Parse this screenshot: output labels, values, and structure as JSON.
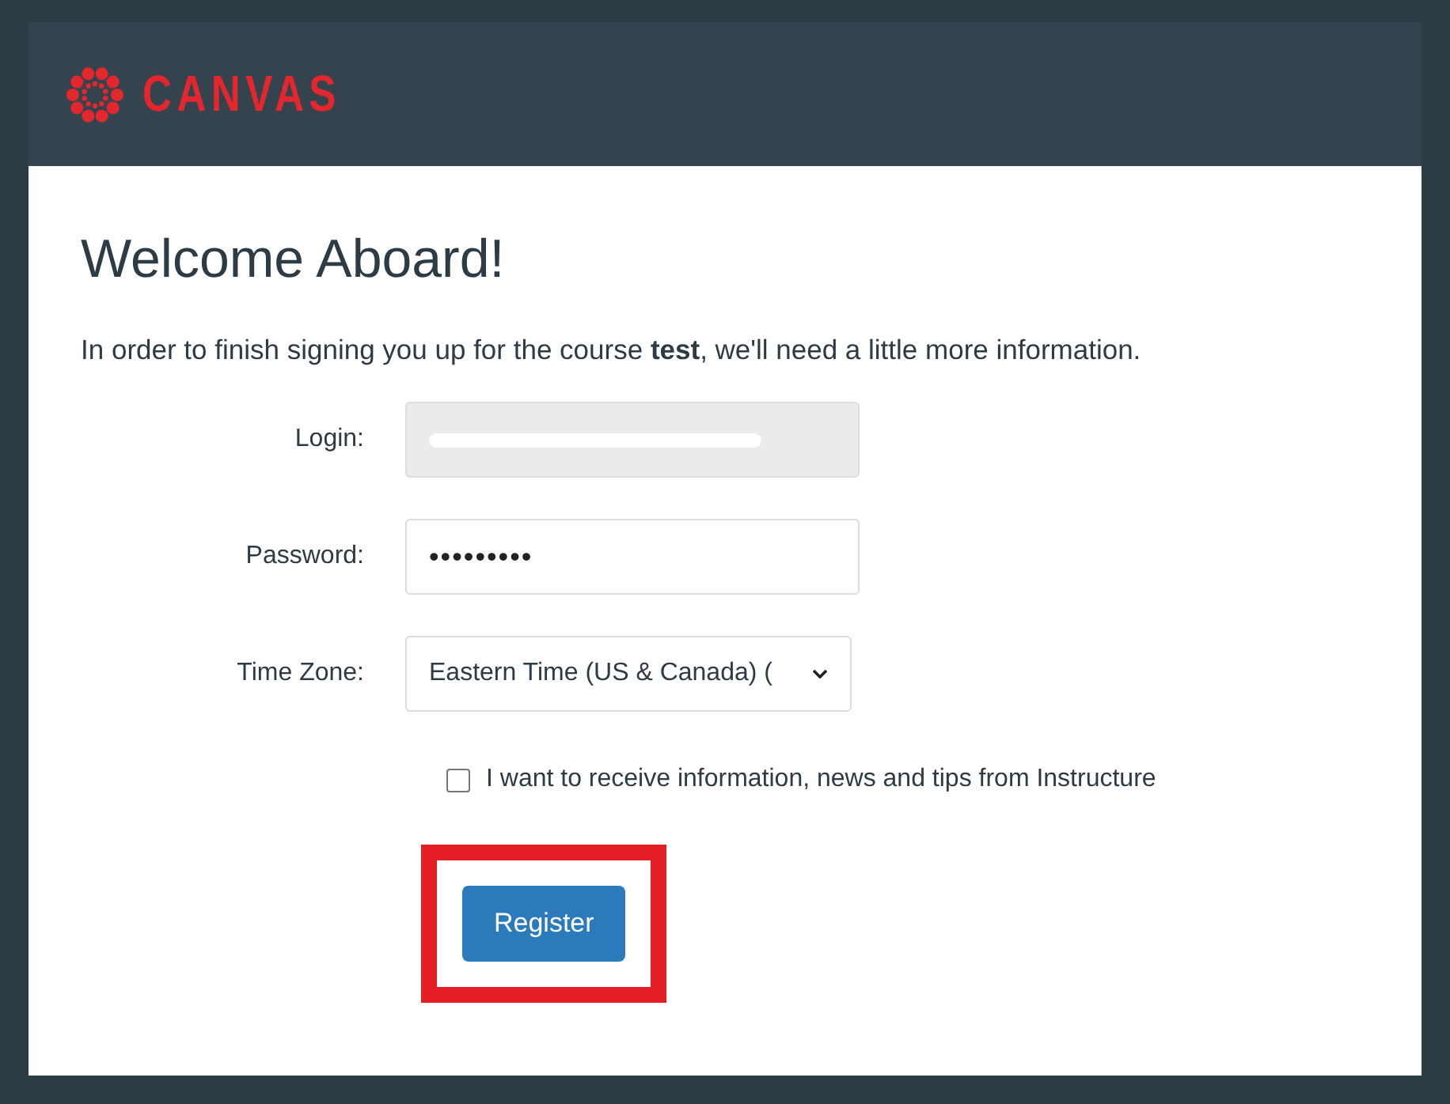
{
  "header": {
    "logo": "CANVAS"
  },
  "title": "Welcome Aboard!",
  "intro": "In order to finish signing you up for the course **test**, we'll need a little more information.",
  "fields": [
    {
      "kind": "redacted",
      "label": "Login:",
      "disabled": true
    },
    {
      "kind": "text",
      "label": "Password:",
      "disabled": false,
      "value": "•••••••••"
    },
    {
      "kind": "select",
      "label": "Time Zone:",
      "disabled": false,
      "value": "Eastern Time (US & Canada) ("
    }
  ],
  "checkbox": {
    "label": "I want to receive information, news and tips from Instructure",
    "checked": false
  },
  "register_button": {
    "label": "Register",
    "highlighted": true
  }
}
